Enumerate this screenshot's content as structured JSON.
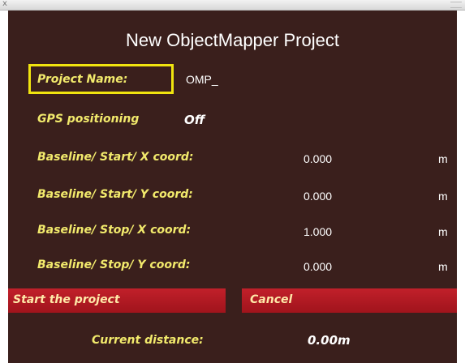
{
  "window": {
    "close_glyph": "x"
  },
  "dialog": {
    "title": "New ObjectMapper Project",
    "project_name": {
      "label": "Project Name:",
      "value": "OMP_"
    },
    "gps": {
      "label": "GPS positioning",
      "value": "Off"
    },
    "fields": [
      {
        "label": "Baseline/ Start/ X coord:",
        "value": "0.000",
        "unit": "m"
      },
      {
        "label": "Baseline/ Start/ Y coord:",
        "value": "0.000",
        "unit": "m"
      },
      {
        "label": "Baseline/ Stop/ X coord:",
        "value": "1.000",
        "unit": "m"
      },
      {
        "label": "Baseline/ Stop/ Y coord:",
        "value": "0.000",
        "unit": "m"
      }
    ],
    "buttons": {
      "start": "Start the project",
      "cancel": "Cancel"
    },
    "distance": {
      "label": "Current distance:",
      "value": "0.00m"
    }
  },
  "colors": {
    "background": "#3a1f1c",
    "label": "#f2ea6c",
    "highlight_border": "#f0e40f",
    "button": "#b01a22",
    "button_text": "#ffe9a8"
  }
}
